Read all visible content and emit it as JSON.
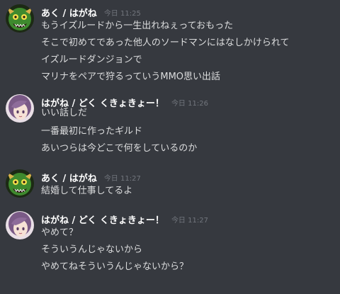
{
  "messages": [
    {
      "user": "あく / はがね",
      "time": "今日 11:25",
      "avatar": "green-goblin-avatar",
      "lines": [
        "もうイズルードから一生出れねぇっておもった",
        "そこで初めてであった他人のソードマンにはなしかけられて",
        "イズルードダンジョンで",
        "マリナをペアで狩るっていうMMO思い出話"
      ]
    },
    {
      "user": "はがね / どく くきょきょー！",
      "time": "今日 11:26",
      "avatar": "purple-hair-avatar",
      "lines": [
        "いい話しだ",
        "一番最初に作ったギルド",
        "あいつらは今どこで何をしているのか"
      ]
    },
    {
      "user": "あく / はがね",
      "time": "今日 11:27",
      "avatar": "green-goblin-avatar",
      "lines": [
        "結婚して仕事してるよ"
      ]
    },
    {
      "user": "はがね / どく くきょきょー！",
      "time": "今日 11:27",
      "avatar": "purple-hair-avatar",
      "lines": [
        "やめて？",
        "そういうんじゃないから",
        "やめてねそういうんじゃないから？"
      ]
    }
  ]
}
